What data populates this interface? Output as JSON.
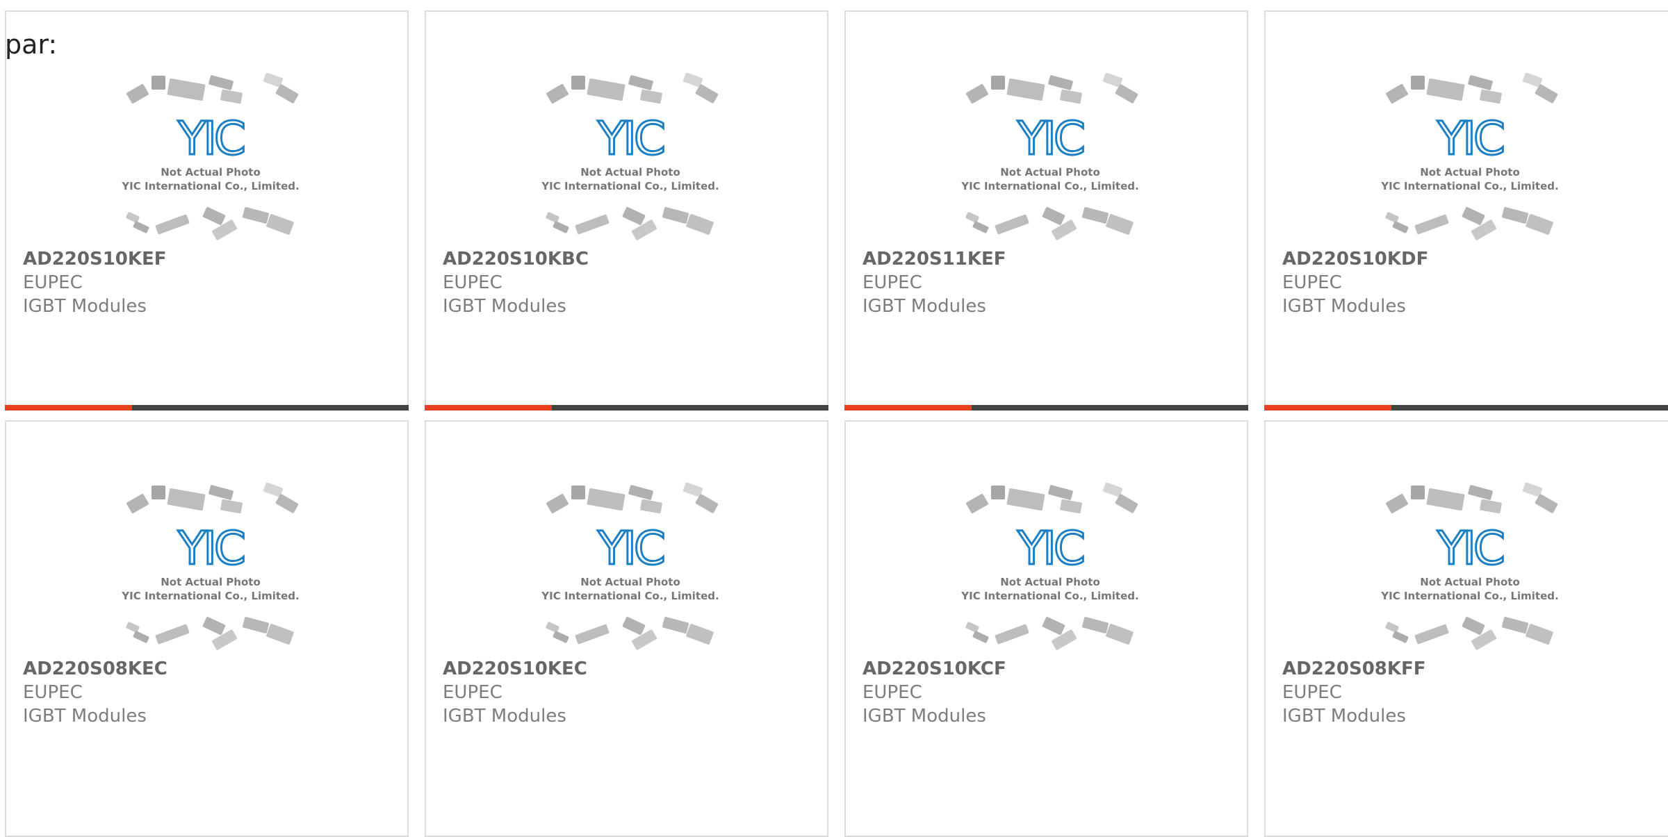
{
  "prefix_label": "par:",
  "placeholder_image": {
    "logo_text": "YIC",
    "caption_line1": "Not Actual Photo",
    "caption_line2": "YIC International Co., Limited."
  },
  "colors": {
    "accent": "#e8401c",
    "bar": "#444444",
    "logo_blue": "#1a7fc4"
  },
  "products": [
    {
      "part_number": "AD220S10KEF",
      "manufacturer": "EUPEC",
      "category": "IGBT Modules"
    },
    {
      "part_number": "AD220S10KBC",
      "manufacturer": "EUPEC",
      "category": "IGBT Modules"
    },
    {
      "part_number": "AD220S11KEF",
      "manufacturer": "EUPEC",
      "category": "IGBT Modules"
    },
    {
      "part_number": "AD220S10KDF",
      "manufacturer": "EUPEC",
      "category": "IGBT Modules"
    },
    {
      "part_number": "AD220S08KEC",
      "manufacturer": "EUPEC",
      "category": "IGBT Modules"
    },
    {
      "part_number": "AD220S10KEC",
      "manufacturer": "EUPEC",
      "category": "IGBT Modules"
    },
    {
      "part_number": "AD220S10KCF",
      "manufacturer": "EUPEC",
      "category": "IGBT Modules"
    },
    {
      "part_number": "AD220S08KFF",
      "manufacturer": "EUPEC",
      "category": "IGBT Modules"
    }
  ]
}
